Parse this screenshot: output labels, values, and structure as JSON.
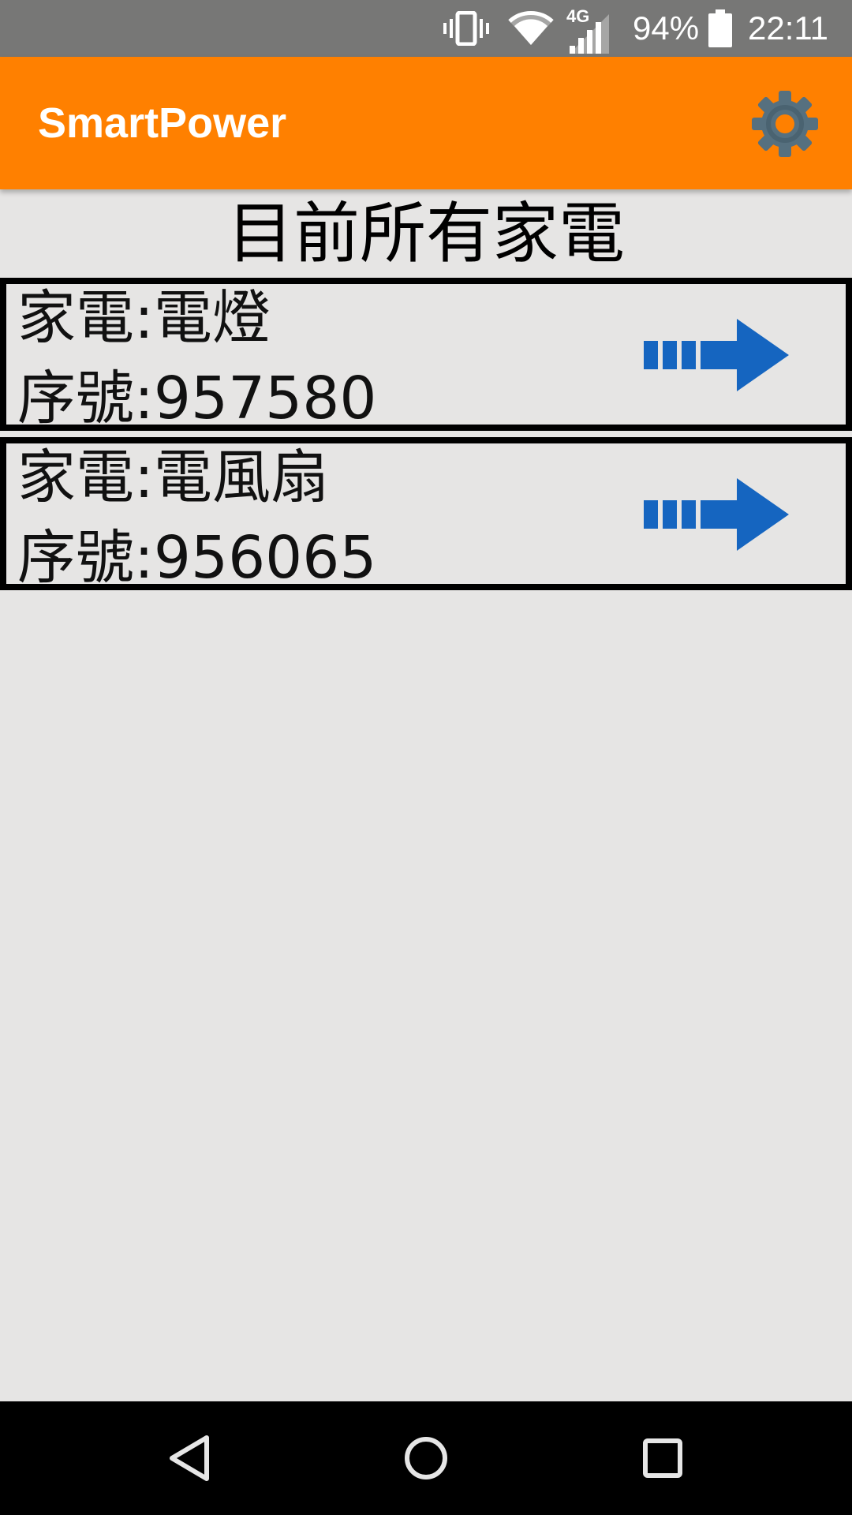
{
  "status_bar": {
    "icons": [
      "vibrate-icon",
      "wifi-icon",
      "cell-signal-4g-icon",
      "battery-icon"
    ],
    "network_label": "4G",
    "battery_percent": "94%",
    "time": "22:11"
  },
  "app_bar": {
    "title": "SmartPower",
    "settings_icon": "gear-icon",
    "gear_color": "#56707f",
    "background_color": "#ff8000"
  },
  "page": {
    "heading": "目前所有家電"
  },
  "appliances": [
    {
      "name_line": "家電:電燈",
      "serial_line": "序號:957580",
      "arrow_icon": "arrow-right-icon"
    },
    {
      "name_line": "家電:電風扇",
      "serial_line": "序號:956065",
      "arrow_icon": "arrow-right-icon"
    }
  ],
  "colors": {
    "arrow": "#1565c0",
    "background": "#e6e5e4"
  },
  "nav_bar": {
    "buttons": [
      "back-icon",
      "home-icon",
      "recents-icon"
    ]
  }
}
